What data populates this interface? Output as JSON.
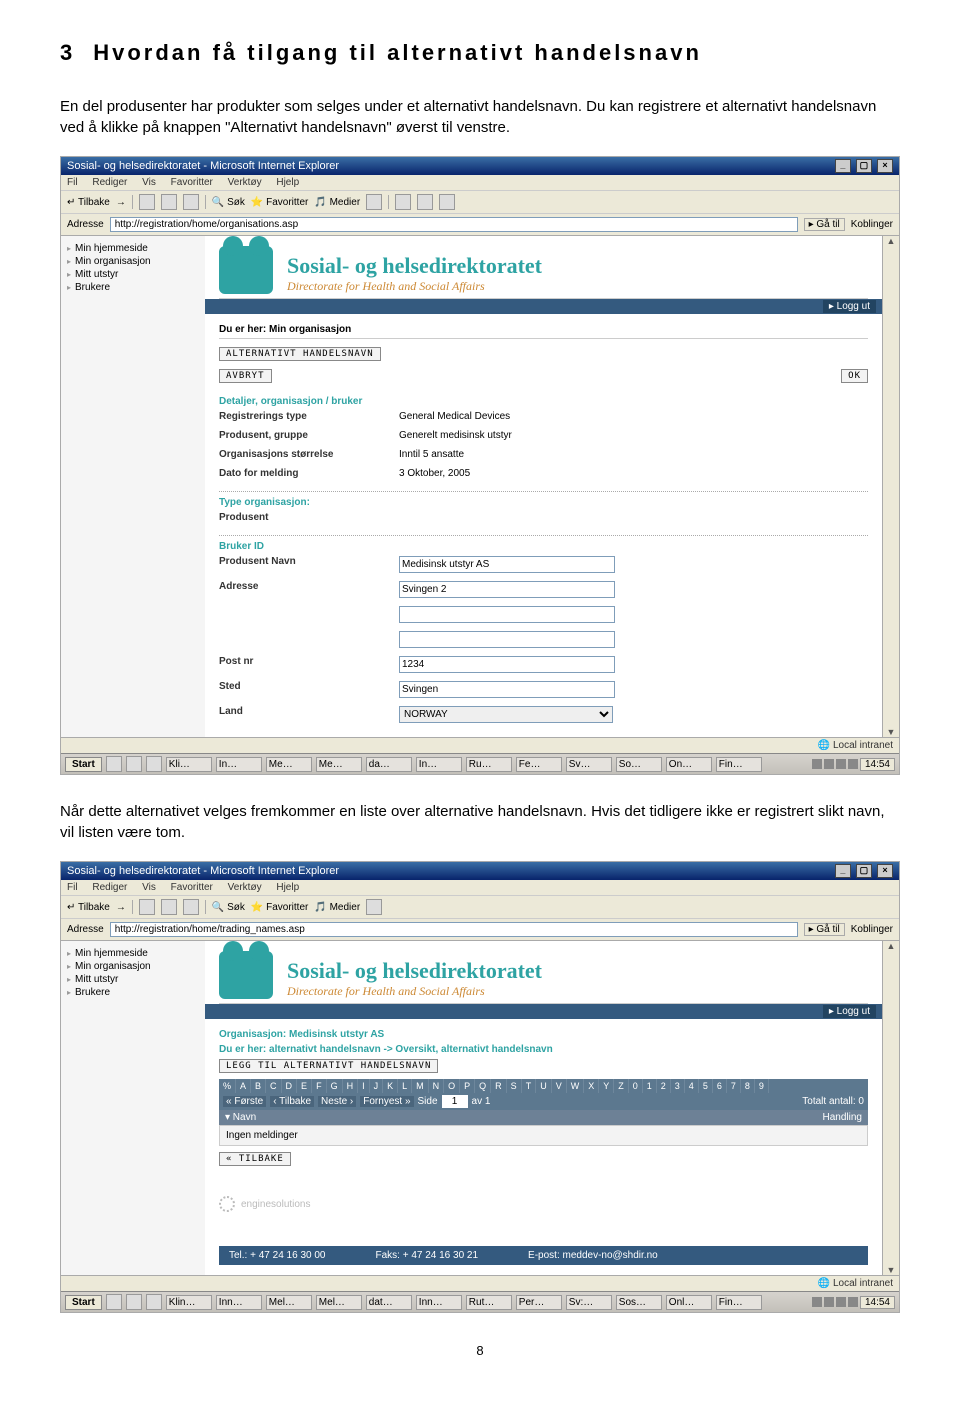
{
  "heading": {
    "num": "3",
    "title": "Hvordan få tilgang til alternativt handelsnavn"
  },
  "para1": "En del produsenter har produkter som selges under et alternativt handelsnavn. Du kan registrere et alternativt handelsnavn ved å klikke på knappen \"Alternativt handelsnavn\" øverst til venstre.",
  "para2": "Når dette alternativet velges fremkommer en liste over alternative handelsnavn. Hvis det tidligere ikke er registrert slikt navn, vil listen være tom.",
  "pageNumber": "8",
  "browser_common": {
    "title": "Sosial- og helsedirektoratet - Microsoft Internet Explorer",
    "menu": [
      "Fil",
      "Rediger",
      "Vis",
      "Favoritter",
      "Verktøy",
      "Hjelp"
    ],
    "tb_back": "Tilbake",
    "tb_sok": "Søk",
    "tb_fav": "Favoritter",
    "tb_media": "Medier",
    "addr_label": "Adresse",
    "go": "Gå til",
    "koblinger": "Koblinger",
    "logo_l1": "Sosial- og helsedirektoratet",
    "logo_l2": "Directorate for Health and Social Affairs",
    "logout": "▸ Logg ut",
    "status_intranet": "Local intranet",
    "start": "Start",
    "clock": "14:54"
  },
  "shot1": {
    "url": "http://registration/home/organisations.asp",
    "sidemenu": [
      "Min hjemmeside",
      "Min organisasjon",
      "Mitt utstyr",
      "Brukere"
    ],
    "crumb": "Du er her: Min organisasjon",
    "btn_alt": "ALTERNATIVT HANDELSNAVN",
    "btn_avbryt": "AVBRYT",
    "btn_ok": "OK",
    "sec_detaljer": "Detaljer, organisasjon / bruker",
    "kv_regtype_k": "Registrerings type",
    "kv_regtype_v": "General Medical Devices",
    "kv_gruppe_k": "Produsent, gruppe",
    "kv_gruppe_v": "Generelt medisinsk utstyr",
    "kv_storrelse_k": "Organisasjons størrelse",
    "kv_storrelse_v": "Inntil 5 ansatte",
    "kv_dato_k": "Dato for melding",
    "kv_dato_v": "3 Oktober, 2005",
    "sec_type": "Type organisasjon:",
    "type_val": "Produsent",
    "sec_brukerid": "Bruker ID",
    "kv_navn_k": "Produsent Navn",
    "kv_navn_v": "Medisinsk utstyr AS",
    "kv_adresse_k": "Adresse",
    "kv_adresse_v": "Svingen 2",
    "kv_postnr_k": "Post nr",
    "kv_postnr_v": "1234",
    "kv_sted_k": "Sted",
    "kv_sted_v": "Svingen",
    "kv_land_k": "Land",
    "kv_land_v": "NORWAY",
    "tasktabs": [
      "Kli…",
      "In…",
      "Me…",
      "Me…",
      "da…",
      "In…",
      "Ru…",
      "Fe…",
      "Sv…",
      "So…",
      "On…",
      "Fin…"
    ]
  },
  "shot2": {
    "url": "http://registration/home/trading_names.asp",
    "sidemenu": [
      "Min hjemmeside",
      "Min organisasjon",
      "Mitt utstyr",
      "Brukere"
    ],
    "org_line": "Organisasjon: Medisinsk utstyr AS",
    "crumb": "Du er her: alternativt handelsnavn -> Oversikt, alternativt handelsnavn",
    "btn_add": "LEGG TIL ALTERNATIVT HANDELSNAVN",
    "alpha": [
      "%",
      "A",
      "B",
      "C",
      "D",
      "E",
      "F",
      "G",
      "H",
      "I",
      "J",
      "K",
      "L",
      "M",
      "N",
      "O",
      "P",
      "Q",
      "R",
      "S",
      "T",
      "U",
      "V",
      "W",
      "X",
      "Y",
      "Z",
      "0",
      "1",
      "2",
      "3",
      "4",
      "5",
      "6",
      "7",
      "8",
      "9"
    ],
    "p_first": "« Første",
    "p_back": "‹ Tilbake",
    "p_next": "Neste ›",
    "p_last": "Fornyest »",
    "p_side": "Side",
    "p_pageval": "1",
    "p_av": "av 1",
    "p_total": "Totalt antall: 0",
    "col_navn": "▾ Navn",
    "col_handling": "Handling",
    "emptymsg": "Ingen meldinger",
    "btn_tilbake": "« TILBAKE",
    "engine": "enginesolutions",
    "tel": "Tel.: + 47 24 16 30 00",
    "faks": "Faks: + 47 24 16 30 21",
    "epost": "E-post: meddev-no@shdir.no",
    "tasktabs": [
      "Klin…",
      "Inn…",
      "Mel…",
      "Mel…",
      "dat…",
      "Inn…",
      "Rut…",
      "Per…",
      "Sv:…",
      "Sos…",
      "Onl…",
      "Fin…"
    ]
  }
}
